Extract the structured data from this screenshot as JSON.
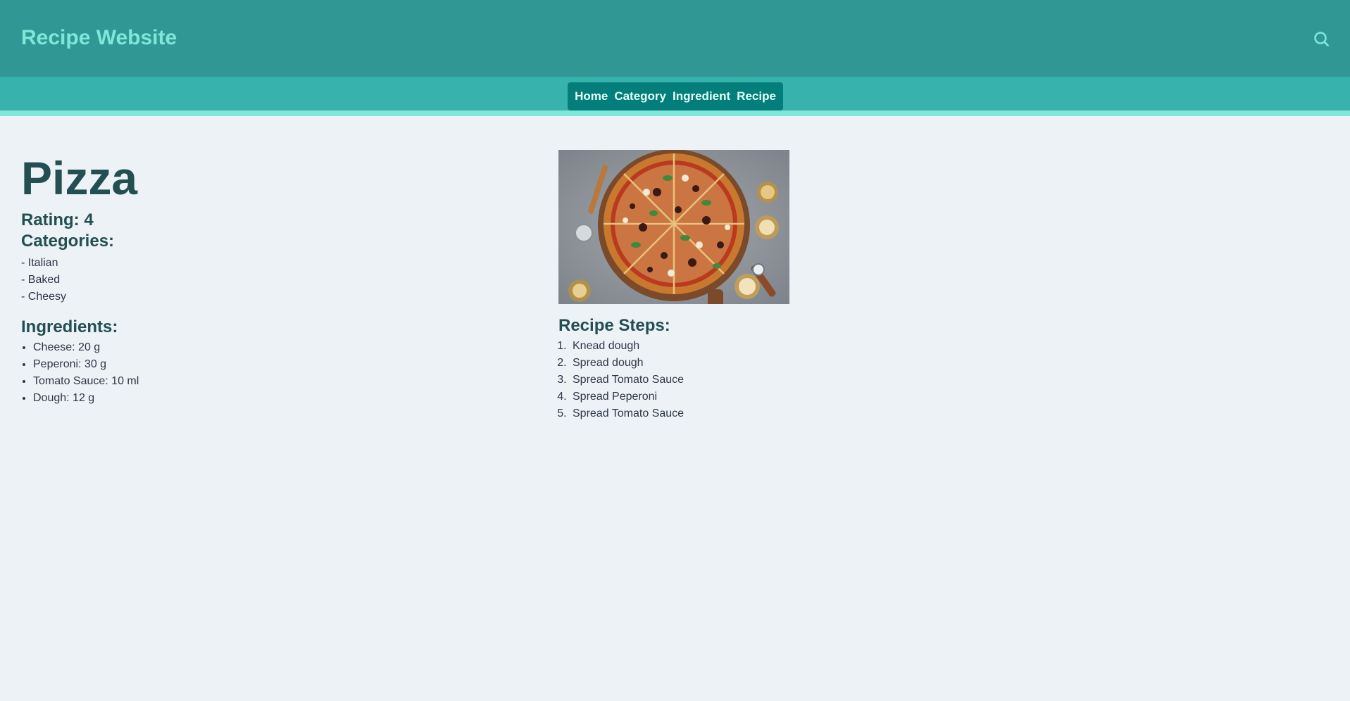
{
  "header": {
    "title": "Recipe Website",
    "search_icon": "search-icon"
  },
  "nav": {
    "items": [
      {
        "label": "Home"
      },
      {
        "label": "Category"
      },
      {
        "label": "Ingredient"
      },
      {
        "label": "Recipe"
      }
    ]
  },
  "recipe": {
    "name": "Pizza",
    "rating_text": "Rating: 4",
    "categories_heading": "Categories:",
    "categories": [
      "- Italian",
      "- Baked",
      "- Cheesy"
    ],
    "ingredients_heading": "Ingredients:",
    "ingredients": [
      "Cheese: 20 g",
      "Peperoni: 30 g",
      "Tomato Sauce: 10 ml",
      "Dough: 12 g"
    ],
    "steps_heading": "Recipe Steps:",
    "steps": [
      "Knead dough",
      "Spread dough",
      "Spread Tomato Sauce",
      "Spread Peperoni",
      "Spread Tomato Sauce"
    ]
  },
  "colors": {
    "header_bg": "#319795",
    "nav_bg": "#38b2ac",
    "nav_pill": "#047e7a",
    "accent_light": "#81e6d9",
    "text_dark": "#234e52",
    "page_bg": "#edf2f7"
  }
}
